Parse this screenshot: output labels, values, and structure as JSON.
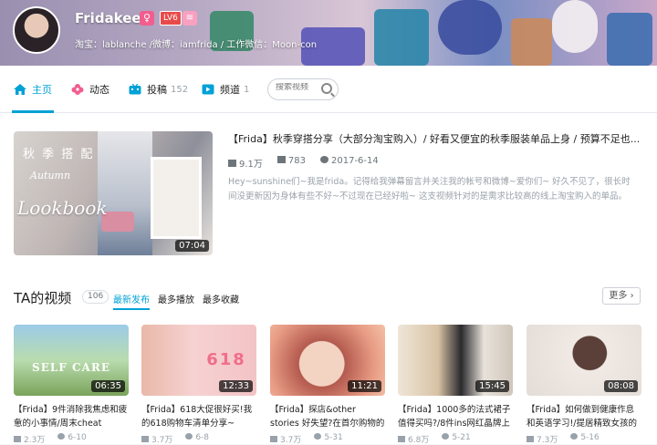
{
  "profile": {
    "name": "Fridakeee",
    "gender_symbol": "♀",
    "level": "LV6",
    "vip_mark": "≋",
    "sign": "淘宝：lablanche /微博：iamfrida / 工作微信：Moon-con"
  },
  "nav": {
    "tabs": [
      {
        "label": "主页",
        "count": "",
        "icon": "home-icon",
        "color": "#00a1d6"
      },
      {
        "label": "动态",
        "count": "",
        "icon": "flower-icon",
        "color": "#f25d8e"
      },
      {
        "label": "投稿",
        "count": "152",
        "icon": "tv-icon",
        "color": "#00a1d6"
      },
      {
        "label": "频道",
        "count": "1",
        "icon": "channel-icon",
        "color": "#00a1d6"
      }
    ],
    "search_placeholder": "搜索视频"
  },
  "featured": {
    "title": "【Frida】秋季穿搭分享（大部分淘宝购入）/ 好看又便宜的秋季服装单品上身 / 预算不足也...",
    "views": "9.1万",
    "danmaku": "783",
    "date": "2017-6-14",
    "description": "Hey~sunshine们~我是frida。记得给我弹幕留言并关注我的帐号和微博~爱你们~ 好久不见了，很长时间没更新因为身体有些不好~不过现在已经好啦~ 这支视频针对的是需求比较高的线上淘宝购入的单品。 价格也",
    "duration": "07:04",
    "thumb_text": {
      "cn": "秋 季 搭 配",
      "en1": "Autumn",
      "en2": "Lookbook"
    }
  },
  "videos_section": {
    "title": "TA的视频",
    "count": "106",
    "sorts": [
      "最新发布",
      "最多播放",
      "最多收藏"
    ],
    "more": "更多"
  },
  "videos": [
    {
      "title": "【Frida】9件消除我焦虑和疲惫的小事情/周末cheat",
      "views": "2.3万",
      "date": "6-10",
      "duration": "06:35",
      "thumb_label": "SELF CARE",
      "bg": "#8fb56c"
    },
    {
      "title": "【Frida】618大促很好买!我的618购物车清单分享~",
      "views": "3.7万",
      "date": "6-8",
      "duration": "12:33",
      "thumb_label": "618",
      "bg": "#f2c6c6"
    },
    {
      "title": "【Frida】探店&other stories 好失望?在首尔购物的",
      "views": "3.7万",
      "date": "5-31",
      "duration": "11:21",
      "thumb_label": "",
      "bg": "#e8b3a5"
    },
    {
      "title": "【Frida】1000多的法式裙子值得买吗?/8件ins网红晶牌上",
      "views": "6.8万",
      "date": "5-21",
      "duration": "15:45",
      "thumb_label": "",
      "bg": "#d8c7b3"
    },
    {
      "title": "【Frida】如何做到健康作息和英语学习!/提居精致女孩的晚",
      "views": "7.3万",
      "date": "5-16",
      "duration": "08:08",
      "thumb_label": "",
      "bg": "#e9e2dc"
    }
  ]
}
